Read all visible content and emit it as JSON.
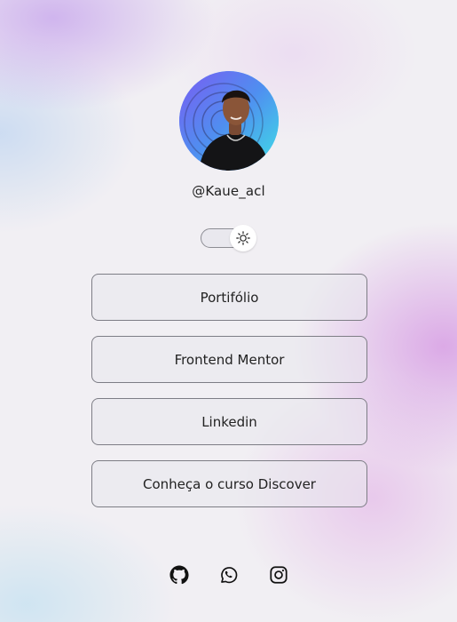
{
  "profile": {
    "username": "@Kaue_acl",
    "avatar_icon": "profile-photo"
  },
  "theme_toggle": {
    "state": "light",
    "icon": "sun-icon"
  },
  "links": [
    {
      "label": "Portifólio"
    },
    {
      "label": "Frontend Mentor"
    },
    {
      "label": "Linkedin"
    },
    {
      "label": "Conheça o curso Discover"
    }
  ],
  "socials": [
    {
      "icon": "github-icon"
    },
    {
      "icon": "whatsapp-icon"
    },
    {
      "icon": "instagram-icon"
    }
  ],
  "colors": {
    "avatar_ring_start": "#6f6cf0",
    "avatar_ring_end": "#38d6e8",
    "button_border": "#7d7d85",
    "text": "#222222"
  }
}
